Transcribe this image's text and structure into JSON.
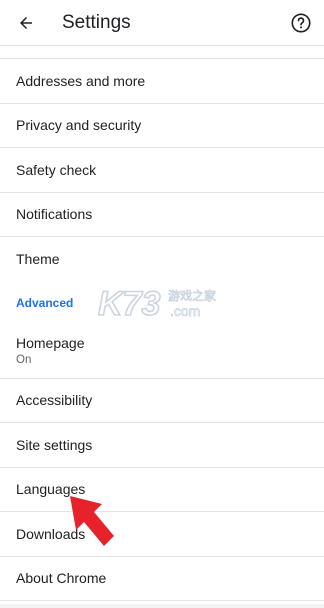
{
  "appbar": {
    "title": "Settings",
    "back_icon": "arrow-back-icon",
    "help_icon": "help-circle-icon"
  },
  "list": {
    "items_basic": [
      {
        "label": "Addresses and more"
      },
      {
        "label": "Privacy and security"
      },
      {
        "label": "Safety check"
      },
      {
        "label": "Notifications"
      },
      {
        "label": "Theme"
      }
    ],
    "advanced_header": "Advanced",
    "homepage": {
      "label": "Homepage",
      "sub": "On"
    },
    "items_advanced": [
      {
        "label": "Accessibility"
      },
      {
        "label": "Site settings"
      },
      {
        "label": "Languages"
      },
      {
        "label": "Downloads"
      },
      {
        "label": "About Chrome"
      }
    ]
  },
  "watermark": {
    "brand": "K73",
    "chinese": "游戏之家",
    "domain": ".com"
  },
  "colors": {
    "accent": "#1a73e8",
    "text_primary": "#202124",
    "text_secondary": "#5f6368",
    "divider": "#e3e3e3",
    "pointer_arrow": "#e8222a"
  }
}
